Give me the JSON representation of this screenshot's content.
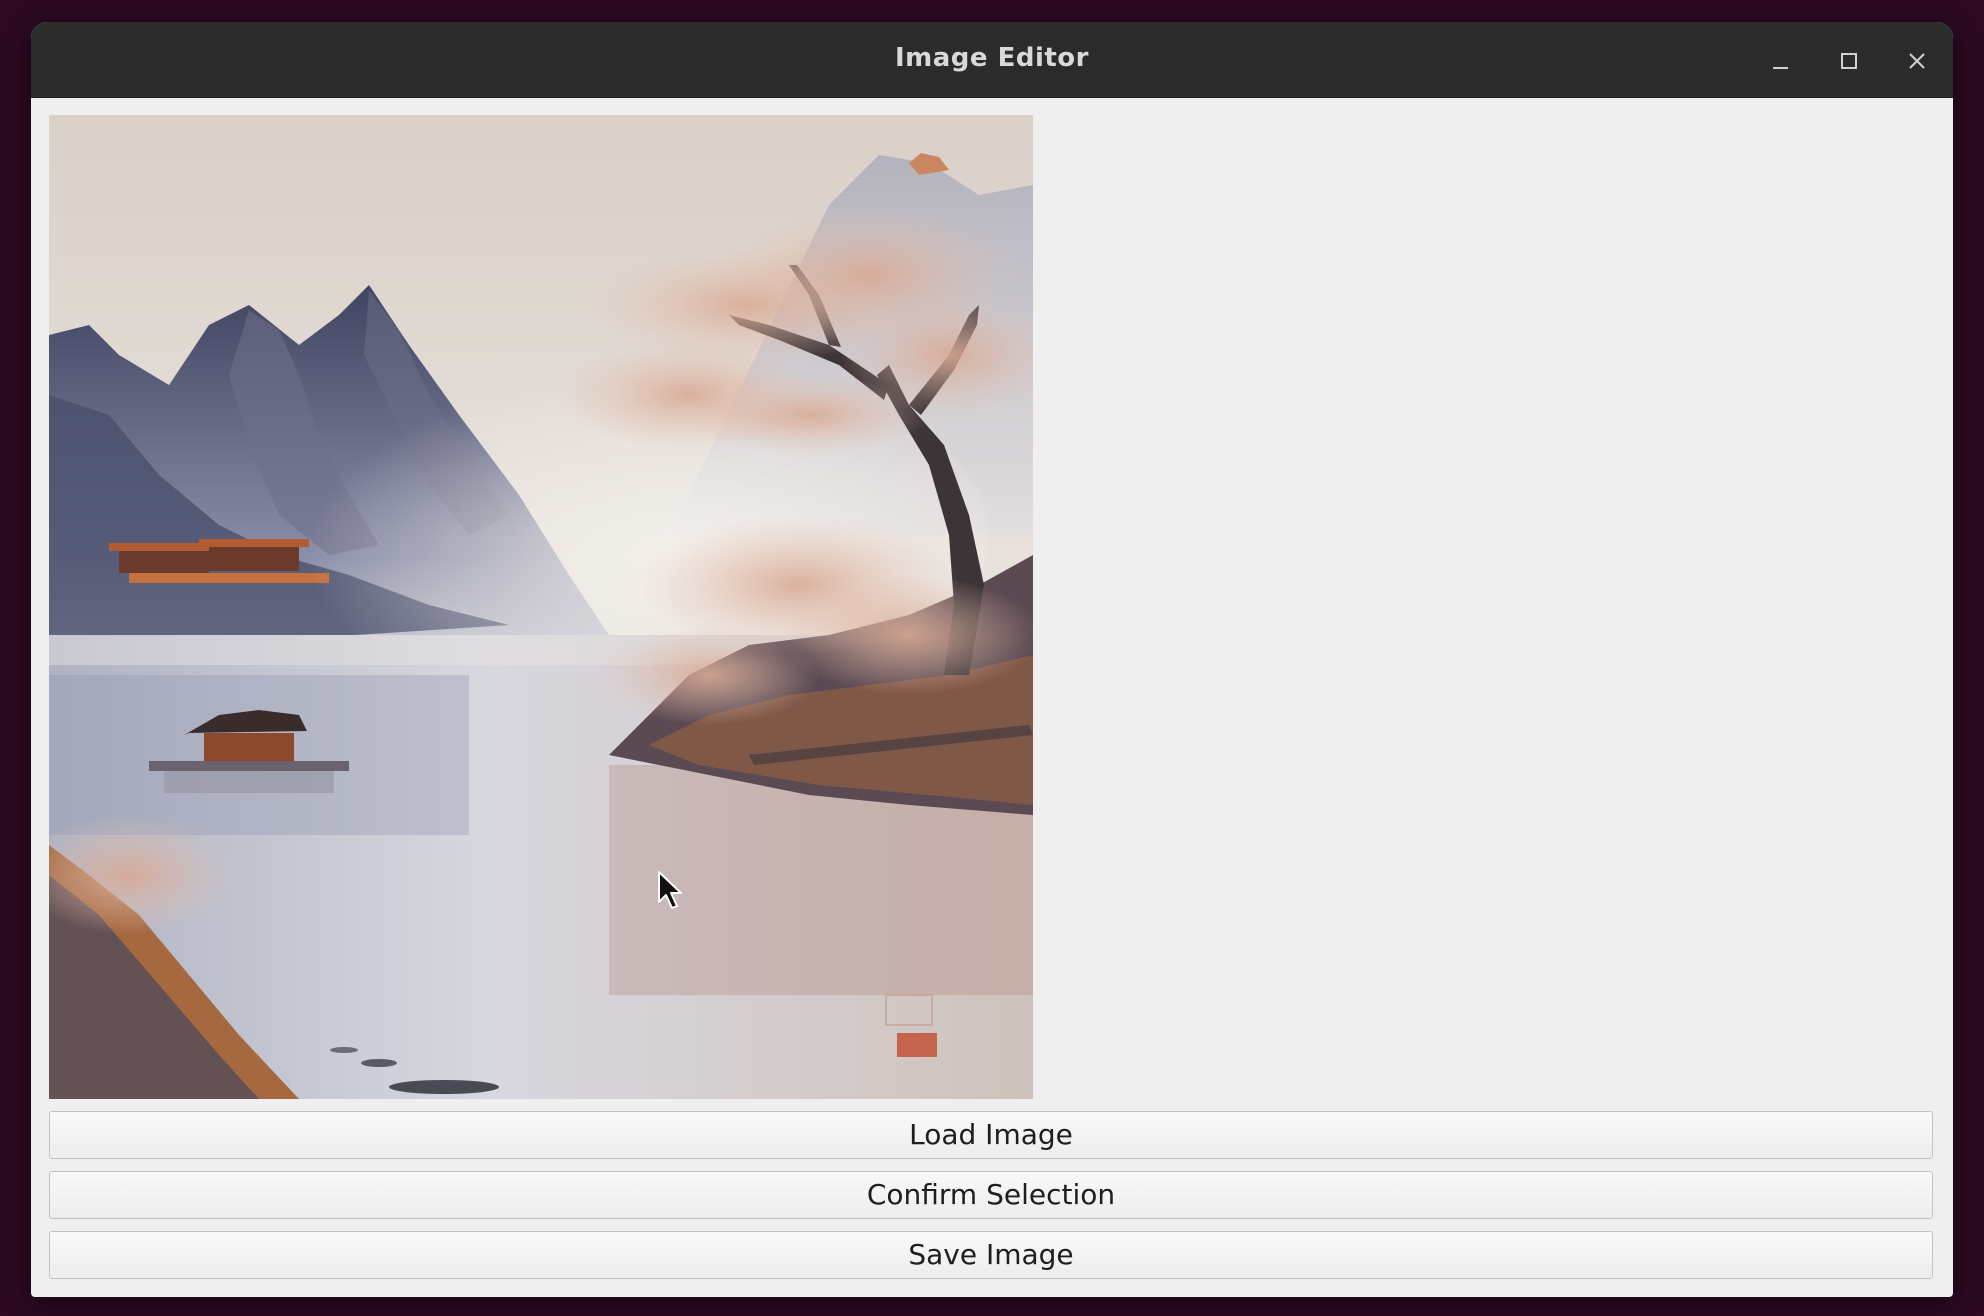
{
  "window": {
    "title": "Image Editor"
  },
  "controls": {
    "minimize_icon": "minimize-icon",
    "maximize_icon": "maximize-icon",
    "close_icon": "close-icon"
  },
  "image": {
    "description_icon": "landscape-painting",
    "seal_color": "#c4533a"
  },
  "buttons": {
    "load": "Load Image",
    "confirm": "Confirm Selection",
    "save": "Save Image"
  },
  "colors": {
    "titlebar": "#2b2b2b",
    "window_bg": "#efefef",
    "desktop": "#2c0a22"
  }
}
